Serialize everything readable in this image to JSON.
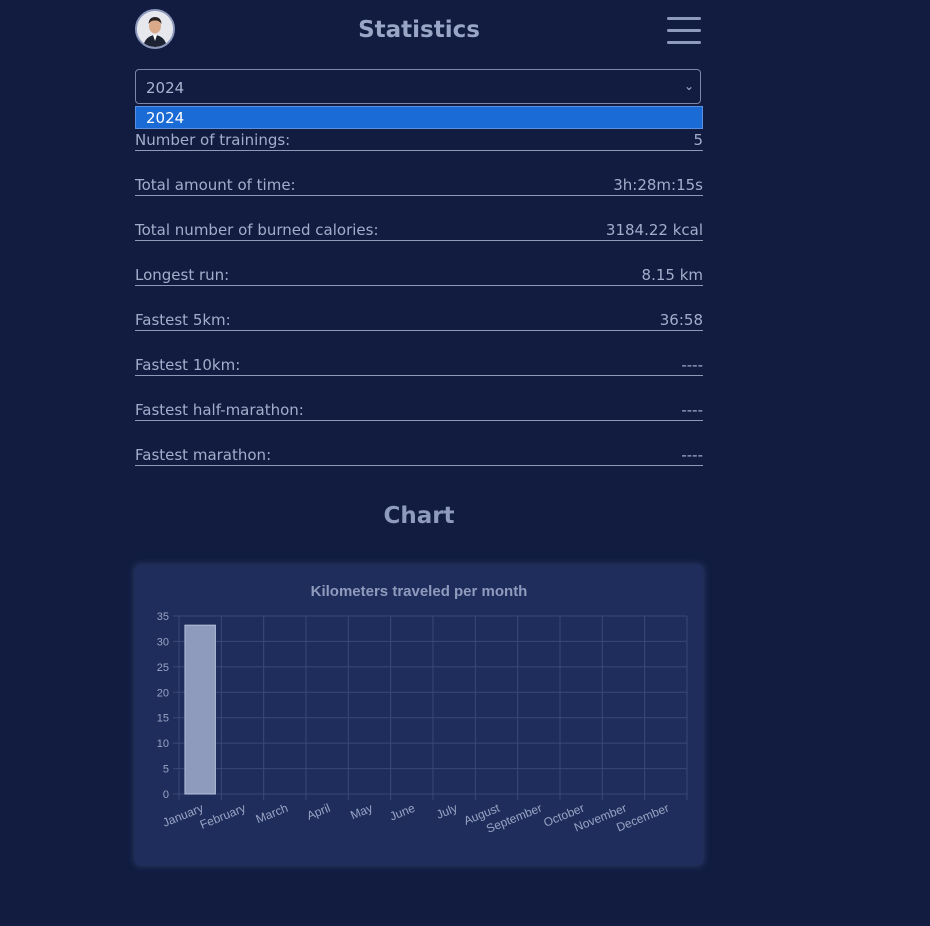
{
  "header": {
    "title": "Statistics"
  },
  "year_select": {
    "selected": "2024",
    "options": [
      "2024"
    ]
  },
  "stats": [
    {
      "label": "Number of trainings:",
      "value": "5"
    },
    {
      "label": "Total amount of time:",
      "value": "3h:28m:15s"
    },
    {
      "label": "Total number of burned calories:",
      "value": "3184.22 kcal"
    },
    {
      "label": "Longest run:",
      "value": "8.15 km"
    },
    {
      "label": "Fastest 5km:",
      "value": "36:58"
    },
    {
      "label": "Fastest 10km:",
      "value": "----"
    },
    {
      "label": "Fastest half-marathon:",
      "value": "----"
    },
    {
      "label": "Fastest marathon:",
      "value": "----"
    }
  ],
  "chart_section": {
    "heading": "Chart"
  },
  "colors": {
    "background": "#111c40",
    "card": "#1f2d5c",
    "bar": "#8f9bbd",
    "dropdown_highlight": "#1a6bd6"
  },
  "chart_data": {
    "type": "bar",
    "title": "Kilometers traveled per month",
    "categories": [
      "January",
      "February",
      "March",
      "April",
      "May",
      "June",
      "July",
      "August",
      "September",
      "October",
      "November",
      "December"
    ],
    "values": [
      33.2,
      0,
      0,
      0,
      0,
      0,
      0,
      0,
      0,
      0,
      0,
      0
    ],
    "ylim": [
      0,
      35
    ],
    "yticks": [
      0,
      5,
      10,
      15,
      20,
      25,
      30,
      35
    ],
    "grid": true
  }
}
